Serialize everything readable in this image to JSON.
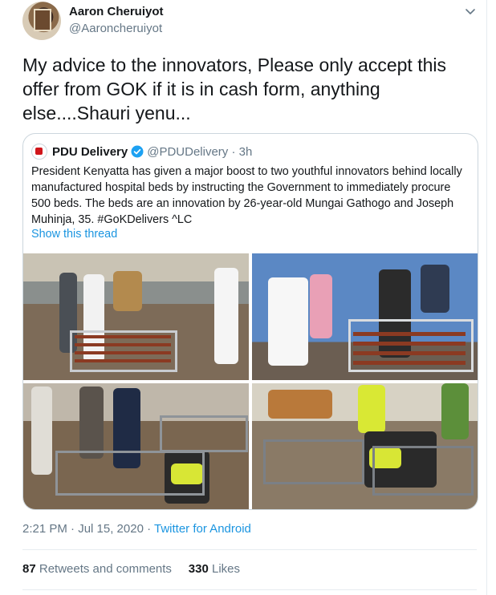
{
  "tweet": {
    "author_name": "Aaron Cheruiyot",
    "author_handle": "@Aaroncheruiyot",
    "text": "My advice to the innovators, Please only accept this offer from GOK if it is in cash form, anything else....Shauri yenu...",
    "timestamp": "2:21 PM · Jul 15, 2020",
    "separator": " · ",
    "source": "Twitter for Android",
    "retweets_count": "87",
    "retweets_label": "Retweets and comments",
    "likes_count": "330",
    "likes_label": "Likes"
  },
  "quoted": {
    "name": "PDU Delivery",
    "handle": "@PDUDelivery",
    "time": "· 3h",
    "text": "President Kenyatta has given a major boost to two youthful innovators behind locally manufactured hospital beds by instructing the Government to immediately procure 500 beds. The beds are an innovation by 26-year-old Mungai Gathogo and Joseph Muhinja, 35. #GoKDelivers ^LC",
    "show_thread": "Show this thread",
    "photos": [
      "photo-officials-inspect-bed",
      "photo-man-in-white-shirt-with-bed",
      "photo-workers-assembling-frames",
      "photo-worker-welding-bed-frame"
    ]
  },
  "icons": {
    "caret": "chevron-down-icon",
    "verified": "verified-badge-icon"
  },
  "colors": {
    "link": "#1b95e0",
    "secondary": "#657786",
    "primary_text": "#14171a",
    "verified": "#1da1f2",
    "border": "#ccd6dd"
  }
}
